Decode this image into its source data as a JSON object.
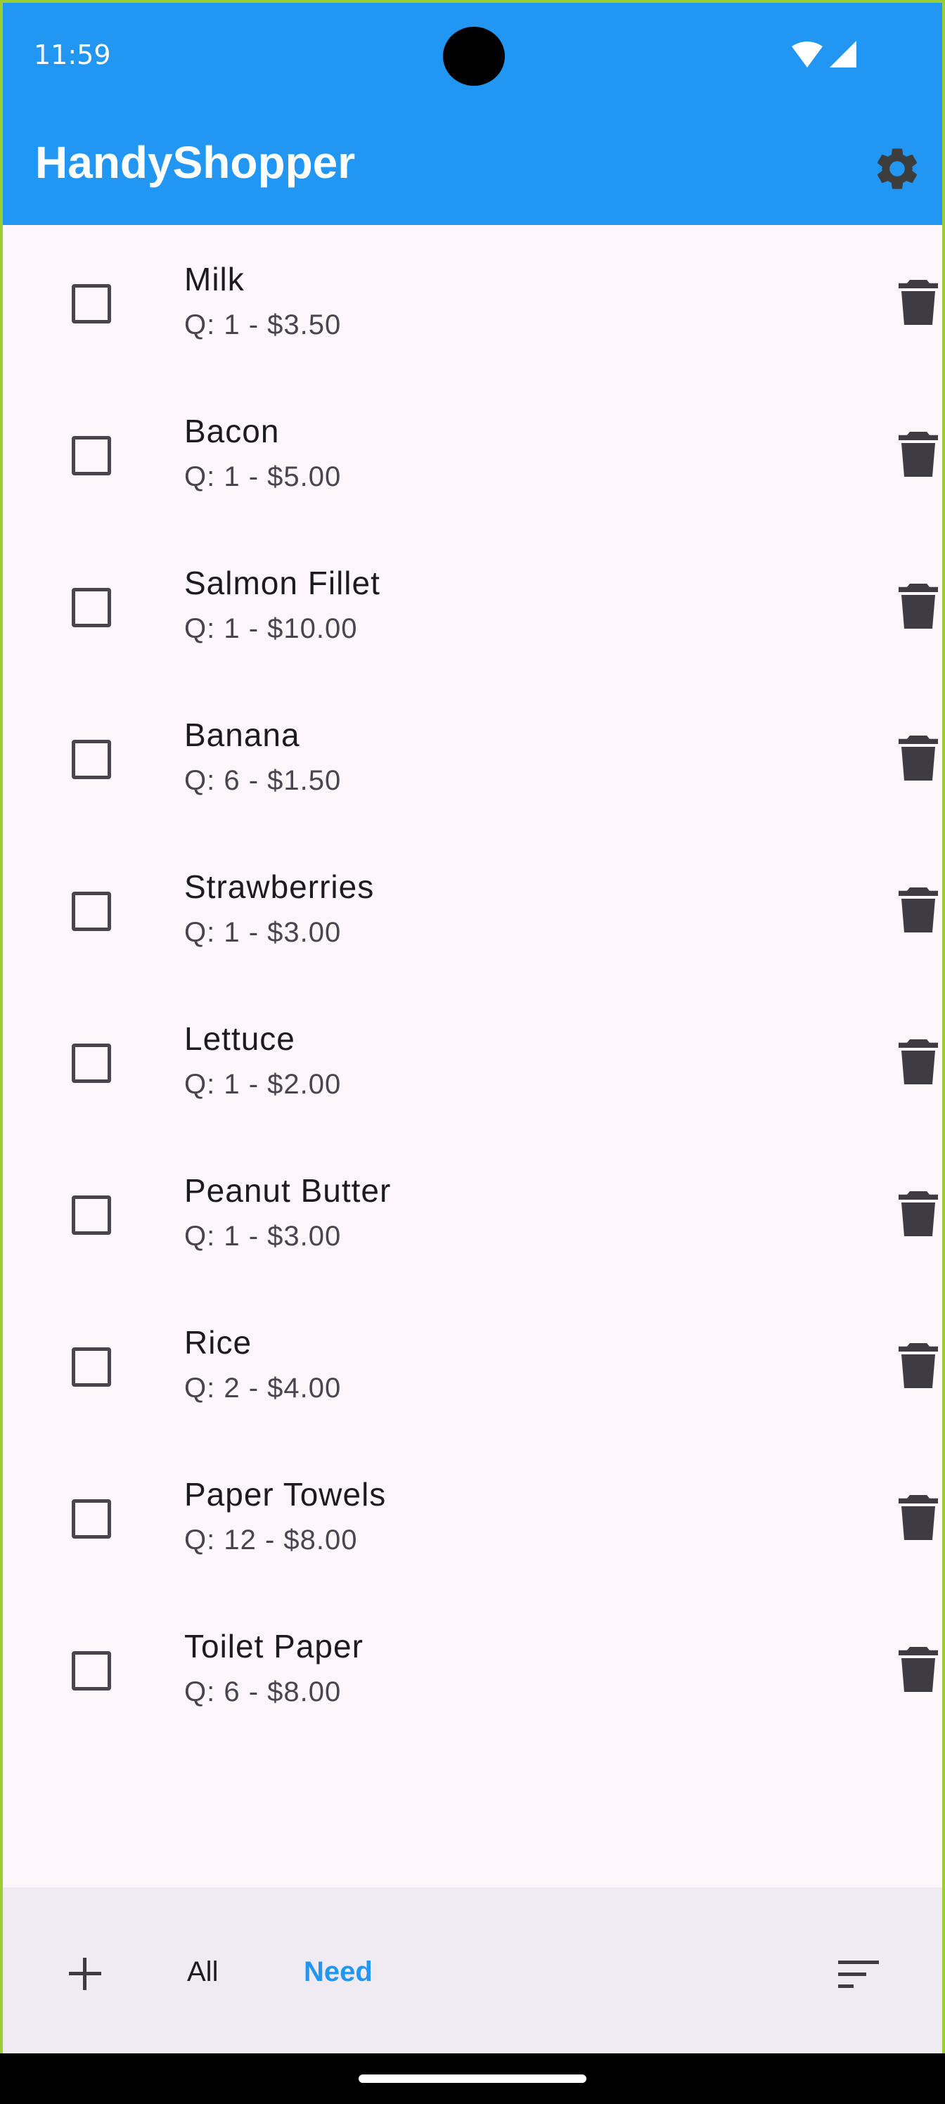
{
  "status": {
    "time": "11:59"
  },
  "app": {
    "title": "HandyShopper"
  },
  "items": [
    {
      "name": "Milk",
      "detail": "Q: 1 - $3.50"
    },
    {
      "name": "Bacon",
      "detail": "Q: 1 - $5.00"
    },
    {
      "name": "Salmon Fillet",
      "detail": "Q: 1 - $10.00"
    },
    {
      "name": "Banana",
      "detail": "Q: 6 - $1.50"
    },
    {
      "name": "Strawberries",
      "detail": "Q: 1 - $3.00"
    },
    {
      "name": "Lettuce",
      "detail": "Q: 1 - $2.00"
    },
    {
      "name": "Peanut Butter",
      "detail": "Q: 1 - $3.00"
    },
    {
      "name": "Rice",
      "detail": "Q: 2 - $4.00"
    },
    {
      "name": "Paper Towels",
      "detail": "Q: 12 - $8.00"
    },
    {
      "name": "Toilet Paper",
      "detail": "Q: 6 - $8.00"
    }
  ],
  "bottom": {
    "all_label": "All",
    "need_label": "Need"
  },
  "colors": {
    "primary": "#2196f3",
    "background": "#fdf7fc",
    "bottom_bar": "#f0eaf3"
  }
}
